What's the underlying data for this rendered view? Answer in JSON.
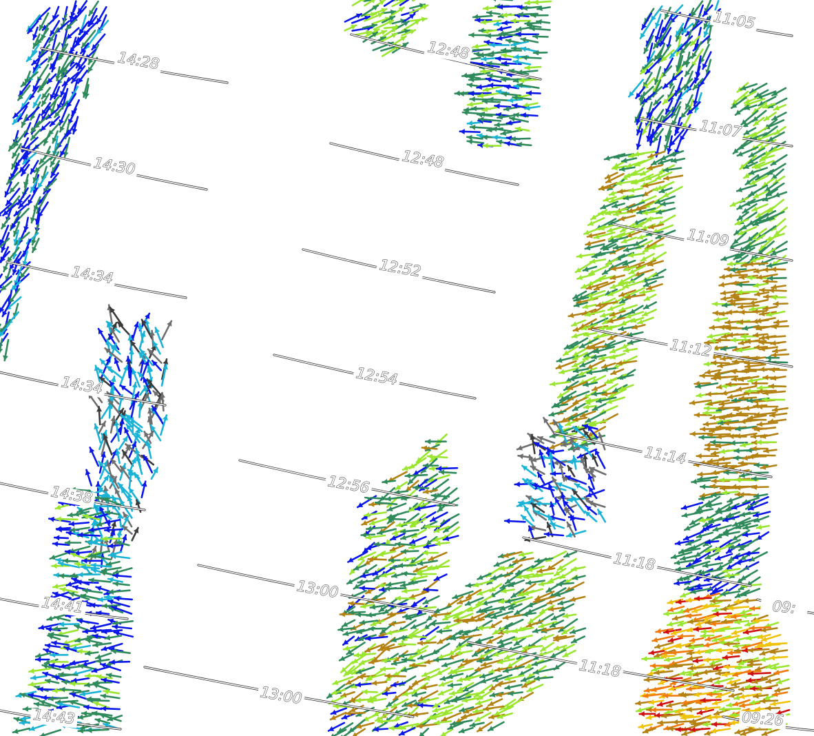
{
  "map": {
    "palette": {
      "blue": "#0a17e8",
      "cyan": "#1ab3d6",
      "teal": "#2e8a5a",
      "lime": "#9ae62e",
      "brown": "#b38213",
      "yellow": "#f0c20a",
      "orange": "#f07a0a",
      "red": "#d01010",
      "gray": "#6e6e6e",
      "darkgray": "#3a3a3a"
    },
    "time_labels": [
      "14:28",
      "14:30",
      "14:34",
      "14:34",
      "14:38",
      "14:41",
      "14:43",
      "12:48",
      "12:48",
      "12:52",
      "12:54",
      "12:56",
      "13:00",
      "13:00",
      "11:05",
      "11:07",
      "11:09",
      "11:12",
      "11:14",
      "11:18",
      "11:18",
      "09:",
      "09:26"
    ]
  }
}
